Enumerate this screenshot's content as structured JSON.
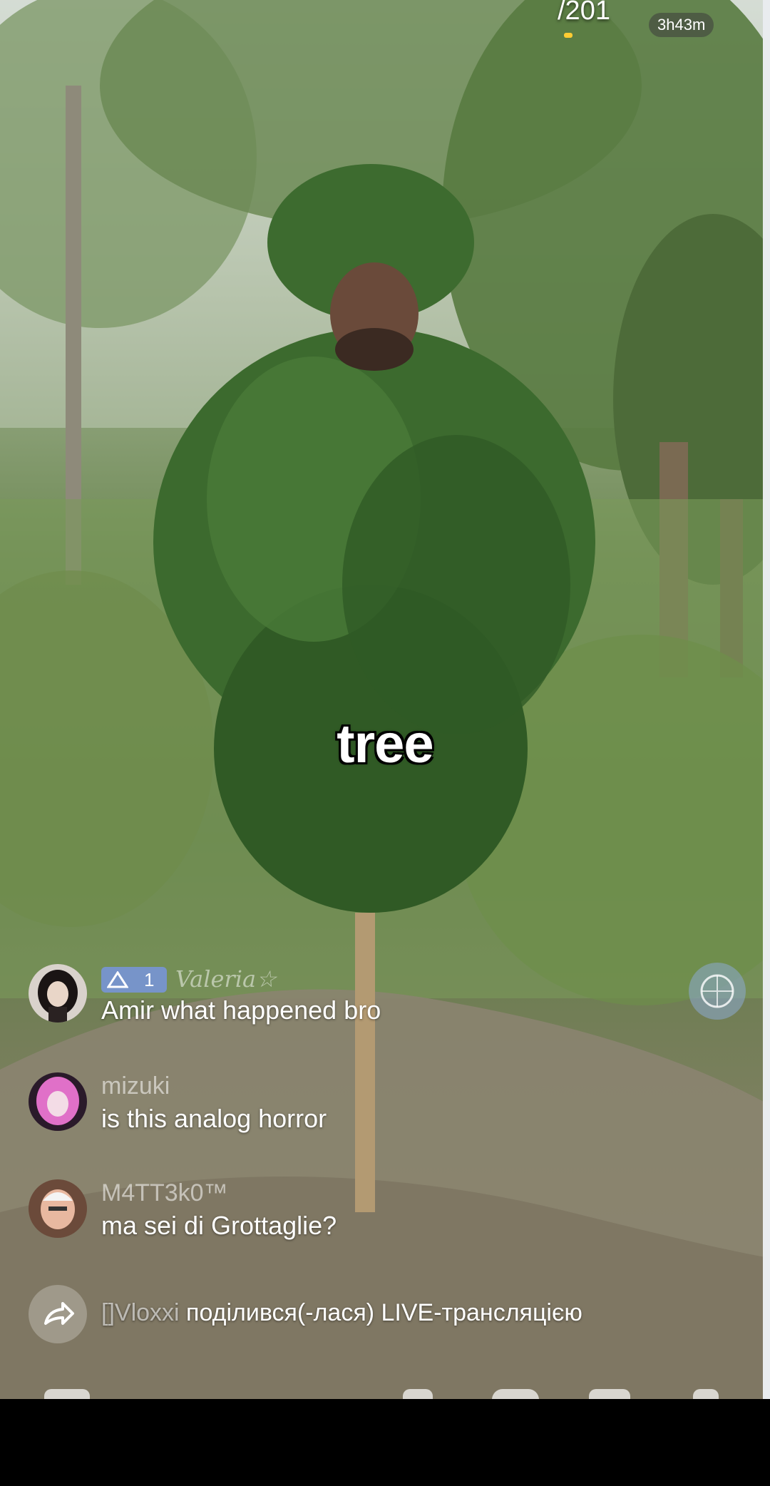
{
  "header": {
    "viewer_count": "/201",
    "duration": "3h43m"
  },
  "caption": "tree",
  "comments": [
    {
      "username": "Valeria☆",
      "badge_level": "1",
      "text": "Amir what happened bro",
      "avatar": "girl-avatar"
    },
    {
      "username": "mizuki",
      "text": "is this analog horror",
      "avatar": "pink-hair-avatar"
    },
    {
      "username": "M4TT3k0™",
      "text": "ma sei di Grottaglie?",
      "avatar": "man-avatar"
    }
  ],
  "share_notice": {
    "username": "[]Vloxxi",
    "text": " поділився(-лася) LIVE-трансляцією",
    "icon": "share-arrow-icon"
  },
  "colors": {
    "accent_badge": "#7896e6",
    "timer_dot": "#ffcc33"
  }
}
